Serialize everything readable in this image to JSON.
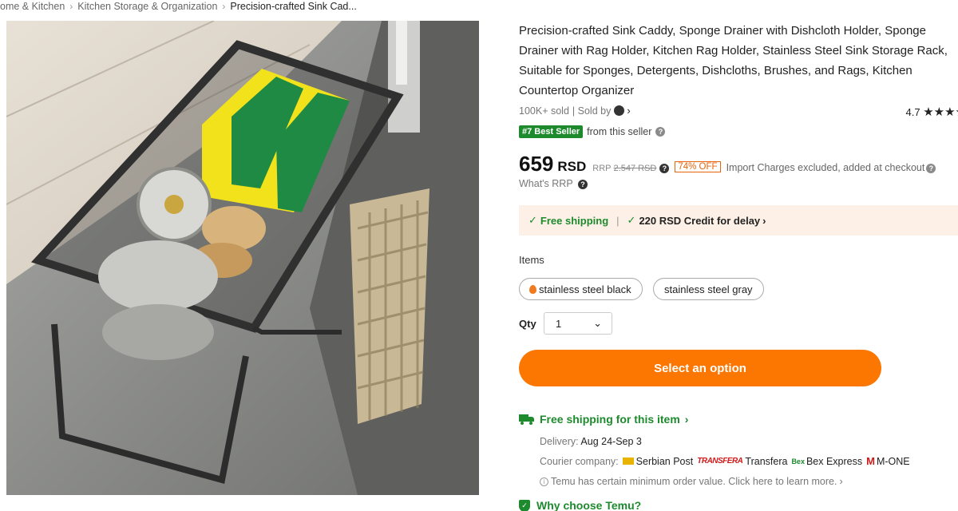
{
  "breadcrumb": {
    "items": [
      "ome & Kitchen",
      "Kitchen Storage & Organization",
      "Precision-crafted Sink Cad..."
    ],
    "separator": "›"
  },
  "product": {
    "title": "Precision-crafted Sink Caddy, Sponge Drainer with Dishcloth Holder, Sponge Drainer with Rag Holder, Kitchen Rag Holder, Stainless Steel Sink Storage Rack, Suitable for Sponges, Detergents, Dishcloths, Brushes, and Rags, Kitchen Countertop Organizer",
    "sold": "100K+ sold",
    "sold_by": "| Sold by",
    "rating": "4.7",
    "stars": "★★★★",
    "bestseller_badge": "#7 Best Seller",
    "bestseller_suffix": "from this seller"
  },
  "price": {
    "amount": "659",
    "currency": "RSD",
    "rrp_label": "RRP",
    "rrp_value": "2.547 RSD",
    "discount": "74% OFF",
    "import_note": "Import Charges excluded, added at checkout",
    "whats_rrp": "What's RRP"
  },
  "shipping_banner": {
    "free_shipping": "Free shipping",
    "credit": "220 RSD Credit for delay"
  },
  "options": {
    "label": "Items",
    "choices": [
      "stainless steel black",
      "stainless steel gray"
    ]
  },
  "quantity": {
    "label": "Qty",
    "value": "1"
  },
  "cta": {
    "label": "Select an option"
  },
  "delivery": {
    "title": "Free shipping for this item",
    "delivery_label": "Delivery:",
    "delivery_value": "Aug 24-Sep 3",
    "courier_label": "Courier company:",
    "couriers": [
      "Serbian Post",
      "Transfera",
      "Bex Express",
      "M-ONE"
    ],
    "courier_logo_transfera": "TRANSFERA",
    "courier_logo_bex": "Bex",
    "courier_logo_mone": "M",
    "min_order": "Temu has certain minimum order value. Click here to learn more.",
    "why": "Why choose Temu?"
  },
  "colors": {
    "accent_orange": "#fb7701",
    "green": "#1e8a2e",
    "banner_bg": "#fdf1e7"
  }
}
